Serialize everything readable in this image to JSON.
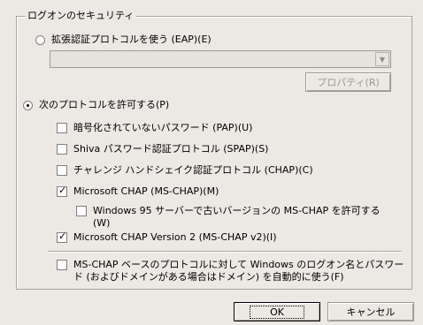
{
  "group": {
    "title": "ログオンのセキュリティ"
  },
  "eap": {
    "radio_label": "拡張認証プロトコルを使う (EAP)(E)",
    "combo_value": "",
    "properties_button": "プロパティ(R)"
  },
  "protocols": {
    "radio_label": "次のプロトコルを許可する(P)",
    "pap": "暗号化されていないパスワード (PAP)(U)",
    "spap": "Shiva パスワード認証プロトコル (SPAP)(S)",
    "chap": "チャレンジ ハンドシェイク認証プロトコル (CHAP)(C)",
    "mschap": "Microsoft CHAP (MS-CHAP)(M)",
    "win95_line1": "Windows 95 サーバーで古いバージョンの MS-CHAP を許可する",
    "win95_line2": "(W)",
    "mschapv2": "Microsoft CHAP Version 2 (MS-CHAP v2)(I)",
    "autologon_line1": "MS-CHAP ベースのプロトコルに対して Windows のログオン名とパスワー",
    "autologon_line2": "ド (およびドメインがある場合はドメイン) を自動的に使う(F)"
  },
  "buttons": {
    "ok": "OK",
    "cancel": "キャンセル"
  }
}
